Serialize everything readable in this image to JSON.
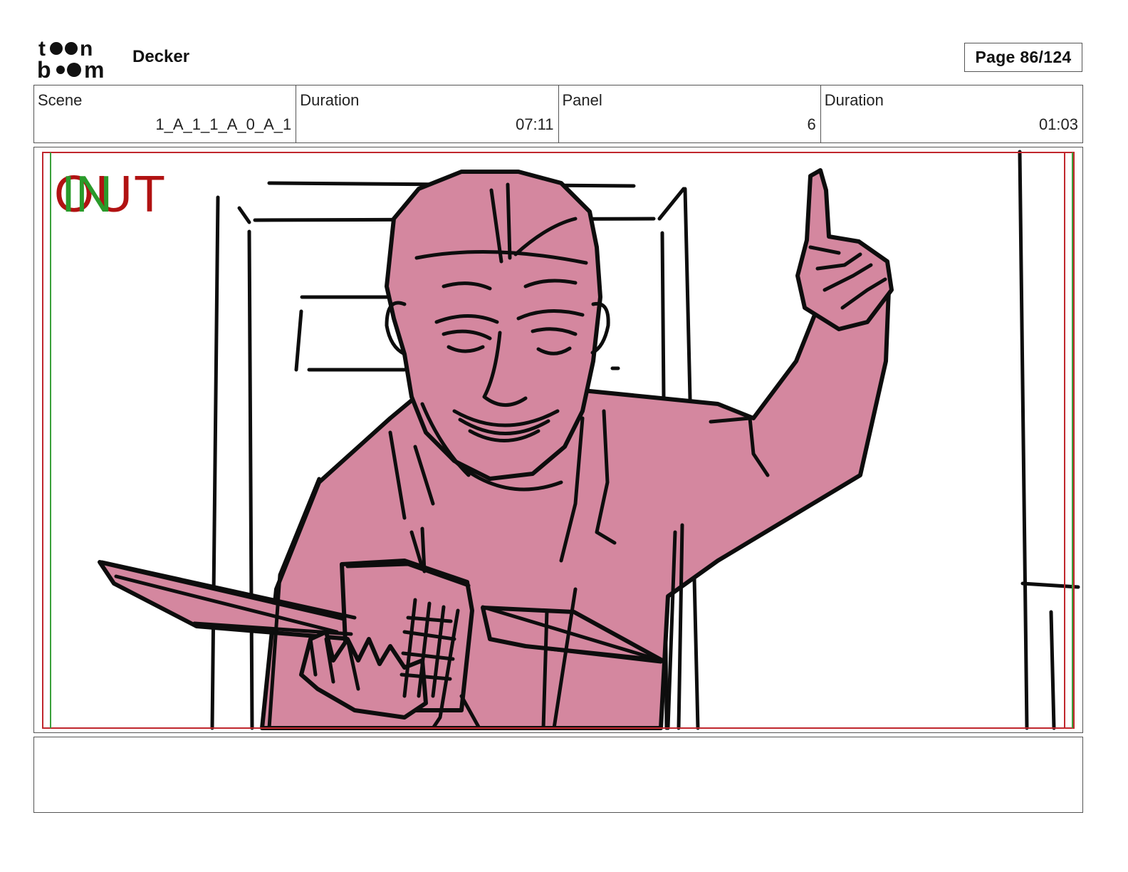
{
  "header": {
    "logo": {
      "line1": "toon",
      "line2": "boom",
      "icon": "toon-boom-logo"
    },
    "project_title": "Decker",
    "page_label": "Page",
    "page_number": "86/124"
  },
  "info": {
    "scene_label": "Scene",
    "scene_value": "1_A_1_1_A_0_A_1",
    "scene_duration_label": "Duration",
    "scene_duration_value": "07:11",
    "panel_label": "Panel",
    "panel_value": "6",
    "panel_duration_label": "Duration",
    "panel_duration_value": "01:03"
  },
  "panel": {
    "in_marker": "IN",
    "out_marker": "OUT",
    "fill_color": "#d4879f",
    "line_color": "#0d0d0d",
    "safe_frame_color": "#c0272d",
    "action_frame_color": "#3aa03a",
    "illustration": "smiling-man-pointing-up-sketch"
  },
  "notes": {
    "text": ""
  }
}
